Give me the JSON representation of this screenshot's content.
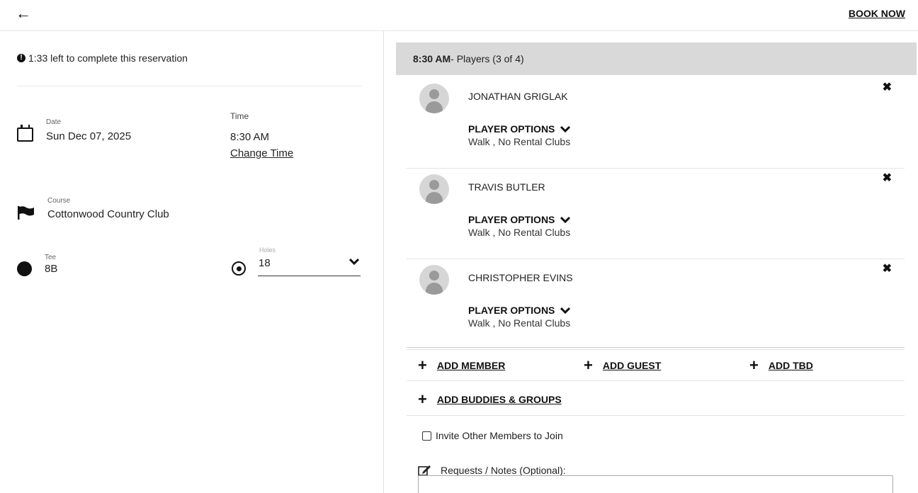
{
  "header": {
    "back_icon": "arrow-left-icon",
    "book_now_label": "BOOK NOW"
  },
  "timer": {
    "text": "1:33 left to complete this reservation",
    "icon": "info-icon"
  },
  "date": {
    "label": "Date",
    "value": "Sun Dec 07, 2025"
  },
  "time": {
    "label": "Time",
    "value": "8:30 AM",
    "change_label": "Change Time"
  },
  "course": {
    "label": "Course",
    "value": "Cottonwood Country Club"
  },
  "tee": {
    "label": "Tee",
    "value": "8B"
  },
  "holes": {
    "label": "Holes",
    "value": "18"
  },
  "players_header": {
    "time": "8:30 AM",
    "rest": " - Players (3 of 4)"
  },
  "players": [
    {
      "name": "JONATHAN GRIGLAK",
      "options_label": "PLAYER OPTIONS",
      "options_value": "Walk , No Rental Clubs"
    },
    {
      "name": "TRAVIS BUTLER",
      "options_label": "PLAYER OPTIONS",
      "options_value": "Walk , No Rental Clubs"
    },
    {
      "name": "CHRISTOPHER EVINS",
      "options_label": "PLAYER OPTIONS",
      "options_value": "Walk , No Rental Clubs"
    }
  ],
  "add_actions": {
    "member": "ADD MEMBER",
    "guest": "ADD GUEST",
    "tbd": "ADD TBD",
    "buddies": "ADD BUDDIES & GROUPS"
  },
  "invite": {
    "label": "Invite Other Members to Join",
    "checked": false
  },
  "notes": {
    "label": "Requests / Notes (Optional):"
  },
  "colors": {
    "header_bg": "#d9d9d9",
    "text": "#222222"
  }
}
